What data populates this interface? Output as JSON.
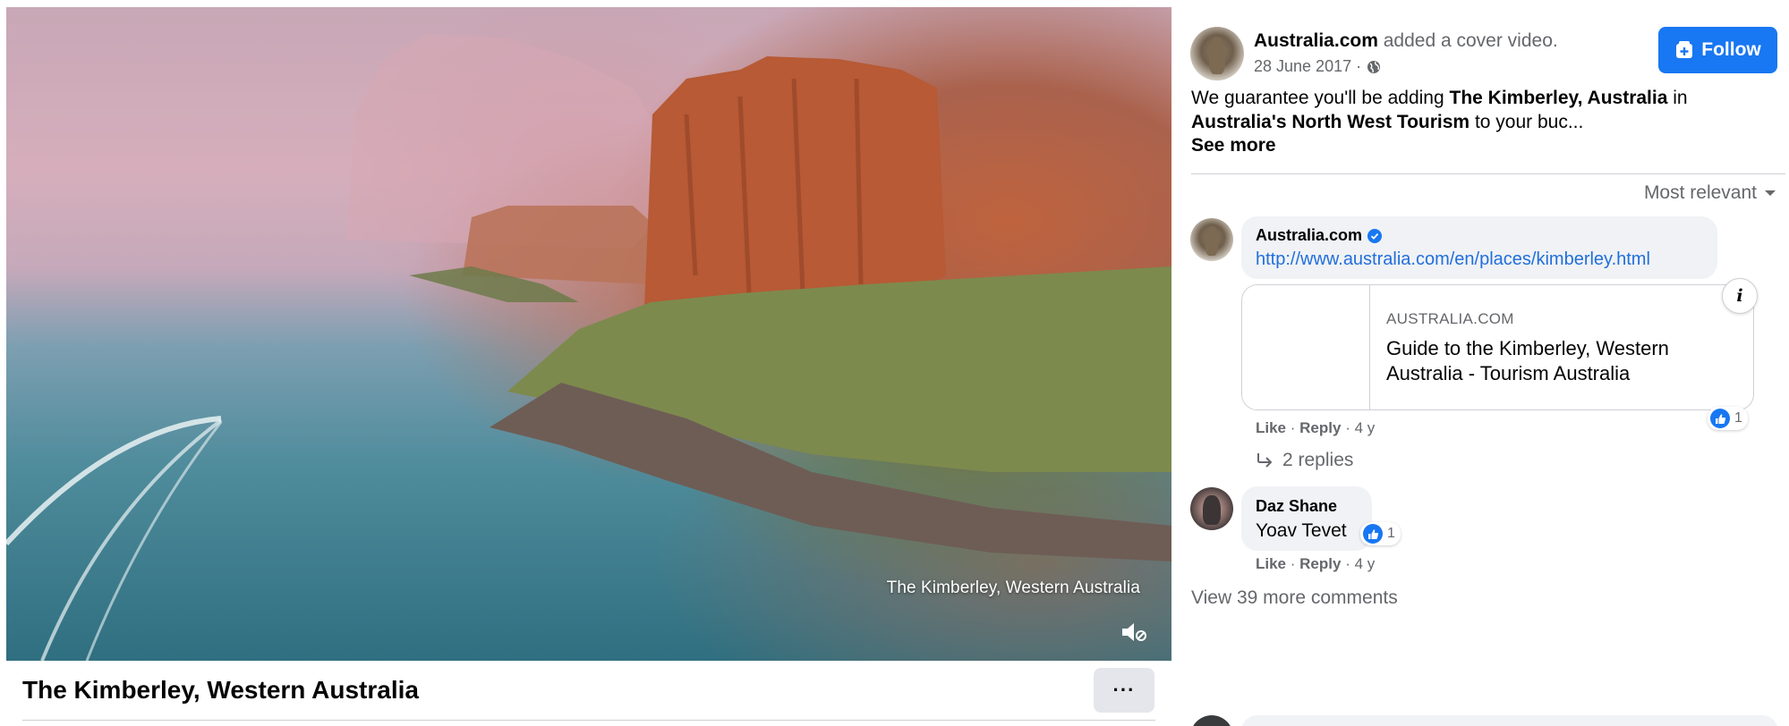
{
  "video": {
    "caption": "The Kimberley, Western Australia",
    "title": "The Kimberley, Western Australia",
    "more_label": "···"
  },
  "post": {
    "author": "Australia.com",
    "action": "added a cover video.",
    "date": "28 June 2017 ·",
    "follow_label": "Follow",
    "text_part1": "We guarantee you'll be adding ",
    "text_bold1": "The Kimberley, Australia",
    "text_part2": " in ",
    "text_bold2": "Australia's North West Tourism",
    "text_part3": " to your buc...",
    "see_more": "See more",
    "sort_label": "Most relevant"
  },
  "comments": [
    {
      "author": "Australia.com",
      "verified": true,
      "link": "http://www.australia.com/en/places/kimberley.html",
      "card_domain": "AUSTRALIA.COM",
      "card_title": "Guide to the Kimberley, Western Australia - Tourism Australia",
      "reactions": "1",
      "like": "Like",
      "reply": "Reply",
      "age": "4 y",
      "replies_label": "2 replies"
    },
    {
      "author": "Daz Shane",
      "text": "Yoav Tevet",
      "reactions": "1",
      "like": "Like",
      "reply": "Reply",
      "age": "4 y"
    }
  ],
  "view_more": "View 39 more comments",
  "colors": {
    "accent": "#1877f2",
    "link": "#216fdb",
    "secondary_text": "#65676b",
    "bubble": "#f0f2f5"
  },
  "icons": [
    "mute-icon",
    "globe-icon",
    "add-page-icon",
    "verified-badge-icon",
    "info-icon",
    "like-icon",
    "reply-arrow-icon",
    "caret-down-icon"
  ]
}
